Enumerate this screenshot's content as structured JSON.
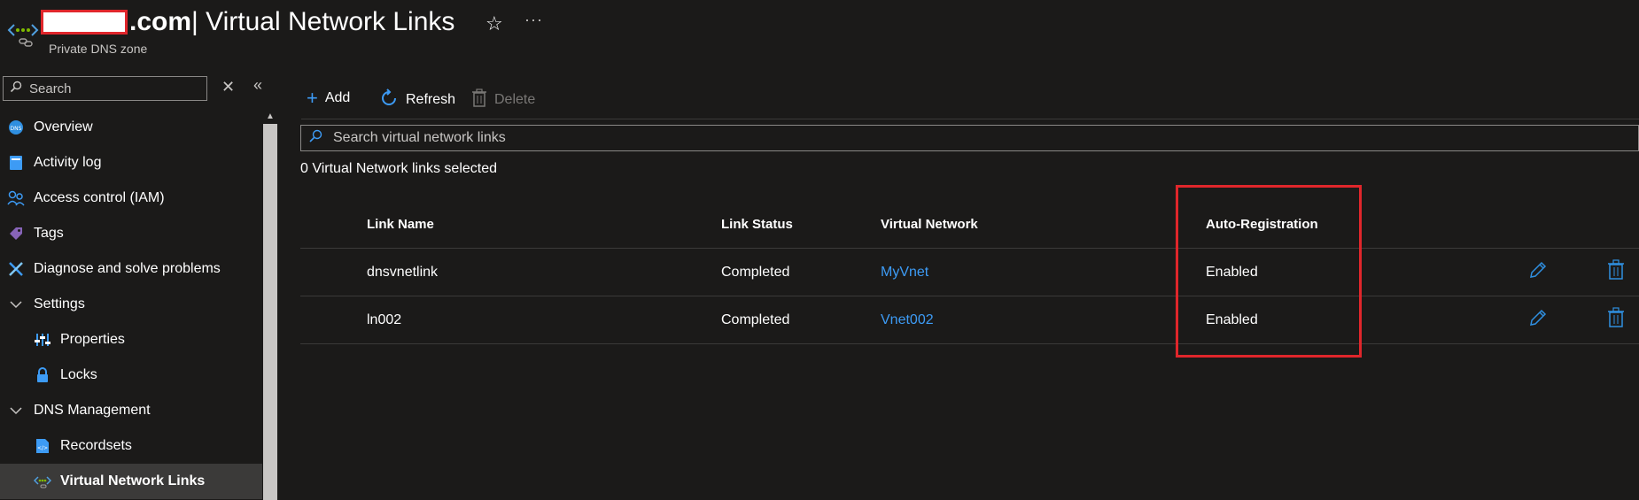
{
  "header": {
    "domain_suffix": ".com",
    "title_rest": " | Virtual Network Links",
    "subtitle": "Private DNS zone",
    "more": "···"
  },
  "sidebar": {
    "search_placeholder": "Search",
    "items": [
      {
        "label": "Overview",
        "icon": "dns-globe-icon"
      },
      {
        "label": "Activity log",
        "icon": "activity-log-icon"
      },
      {
        "label": "Access control (IAM)",
        "icon": "people-icon"
      },
      {
        "label": "Tags",
        "icon": "tag-icon"
      },
      {
        "label": "Diagnose and solve problems",
        "icon": "wrench-icon"
      },
      {
        "label": "Settings",
        "icon": "chevron-down-icon"
      },
      {
        "label": "Properties",
        "icon": "properties-icon"
      },
      {
        "label": "Locks",
        "icon": "lock-icon"
      },
      {
        "label": "DNS Management",
        "icon": "chevron-down-icon"
      },
      {
        "label": "Recordsets",
        "icon": "recordsets-icon"
      },
      {
        "label": "Virtual Network Links",
        "icon": "vnet-link-icon"
      }
    ]
  },
  "toolbar": {
    "add": "Add",
    "refresh": "Refresh",
    "delete": "Delete"
  },
  "grid": {
    "search_placeholder": "Search virtual network links",
    "selected_text": "0 Virtual Network links selected",
    "columns": [
      "Link Name",
      "Link Status",
      "Virtual Network",
      "Auto-Registration"
    ],
    "rows": [
      {
        "link_name": "dnsvnetlink",
        "status": "Completed",
        "vnet": "MyVnet",
        "auto_registration": "Enabled"
      },
      {
        "link_name": "ln002",
        "status": "Completed",
        "vnet": "Vnet002",
        "auto_registration": "Enabled"
      }
    ]
  },
  "colors": {
    "background": "#1b1a19",
    "link": "#3d9bf5",
    "accent": "#2f8fe0",
    "highlight": "#e0262b"
  }
}
